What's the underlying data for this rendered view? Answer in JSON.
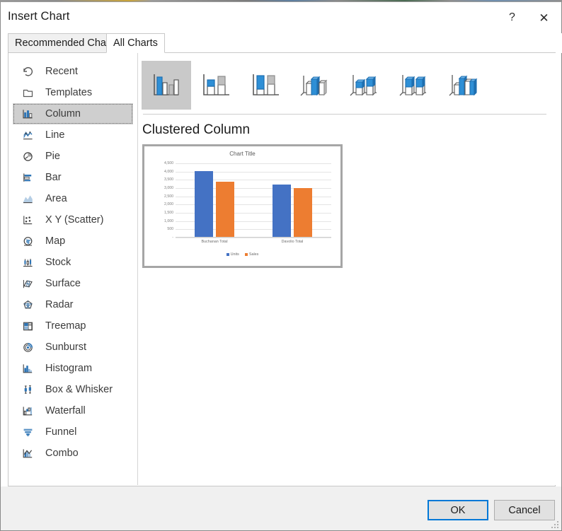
{
  "window": {
    "title": "Insert Chart",
    "help_label": "?",
    "close_label": "✕"
  },
  "tabs": [
    {
      "label": "Recommended Charts",
      "active": false
    },
    {
      "label": "All Charts",
      "active": true
    }
  ],
  "sidebar": {
    "items": [
      {
        "label": "Recent",
        "icon": "recent-icon",
        "selected": false
      },
      {
        "label": "Templates",
        "icon": "templates-icon",
        "selected": false
      },
      {
        "label": "Column",
        "icon": "column-icon",
        "selected": true
      },
      {
        "label": "Line",
        "icon": "line-icon",
        "selected": false
      },
      {
        "label": "Pie",
        "icon": "pie-icon",
        "selected": false
      },
      {
        "label": "Bar",
        "icon": "bar-icon",
        "selected": false
      },
      {
        "label": "Area",
        "icon": "area-icon",
        "selected": false
      },
      {
        "label": "X Y (Scatter)",
        "icon": "scatter-icon",
        "selected": false
      },
      {
        "label": "Map",
        "icon": "map-icon",
        "selected": false
      },
      {
        "label": "Stock",
        "icon": "stock-icon",
        "selected": false
      },
      {
        "label": "Surface",
        "icon": "surface-icon",
        "selected": false
      },
      {
        "label": "Radar",
        "icon": "radar-icon",
        "selected": false
      },
      {
        "label": "Treemap",
        "icon": "treemap-icon",
        "selected": false
      },
      {
        "label": "Sunburst",
        "icon": "sunburst-icon",
        "selected": false
      },
      {
        "label": "Histogram",
        "icon": "histogram-icon",
        "selected": false
      },
      {
        "label": "Box & Whisker",
        "icon": "box-whisker-icon",
        "selected": false
      },
      {
        "label": "Waterfall",
        "icon": "waterfall-icon",
        "selected": false
      },
      {
        "label": "Funnel",
        "icon": "funnel-icon",
        "selected": false
      },
      {
        "label": "Combo",
        "icon": "combo-icon",
        "selected": false
      }
    ]
  },
  "content": {
    "subtype_title": "Clustered Column",
    "thumbnails": [
      {
        "name": "clustered-column",
        "selected": true
      },
      {
        "name": "stacked-column",
        "selected": false
      },
      {
        "name": "100-percent-stacked-column",
        "selected": false
      },
      {
        "name": "3d-clustered-column",
        "selected": false
      },
      {
        "name": "3d-stacked-column",
        "selected": false
      },
      {
        "name": "3d-100-percent-stacked-column",
        "selected": false
      },
      {
        "name": "3d-column",
        "selected": false
      }
    ]
  },
  "chart_data": {
    "type": "bar",
    "title": "Chart Title",
    "xlabel": "",
    "ylabel": "",
    "categories": [
      "Buchanan Total",
      "Davolio Total"
    ],
    "series": [
      {
        "name": "Units",
        "color": "#4472C4",
        "values": [
          4000,
          3180
        ]
      },
      {
        "name": "Sales",
        "color": "#ED7D31",
        "values": [
          3350,
          2960
        ]
      }
    ],
    "ylim": [
      0,
      4500
    ],
    "ytick_labels": [
      "4,500",
      "4,000",
      "3,500",
      "3,000",
      "2,500",
      "2,000",
      "1,500",
      "1,000",
      "500",
      "-"
    ],
    "ytick_values": [
      4500,
      4000,
      3500,
      3000,
      2500,
      2000,
      1500,
      1000,
      500,
      0
    ],
    "grid": true,
    "legend_position": "bottom"
  },
  "footer": {
    "ok_label": "OK",
    "cancel_label": "Cancel"
  },
  "colors": {
    "accent": "#0078D7",
    "series_blue": "#4472C4",
    "series_orange": "#ED7D31",
    "selection_gray": "#C9C9C9"
  }
}
